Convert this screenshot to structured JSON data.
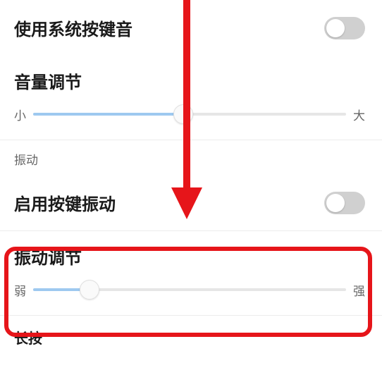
{
  "sound": {
    "useSystemSoundLabel": "使用系统按键音",
    "volumeTitle": "音量调节",
    "volumeMin": "小",
    "volumeMax": "大",
    "volumePercent": 48
  },
  "vibration": {
    "sectionLabel": "振动",
    "enableLabel": "启用按键振动",
    "adjustTitle": "振动调节",
    "adjustMin": "弱",
    "adjustMax": "强",
    "adjustPercent": 18
  },
  "longpress": {
    "label": "长按"
  },
  "toggles": {
    "systemSound": false,
    "enableVibration": false
  },
  "annotation": {
    "arrowColor": "#e6151a",
    "boxColor": "#e6151a"
  }
}
